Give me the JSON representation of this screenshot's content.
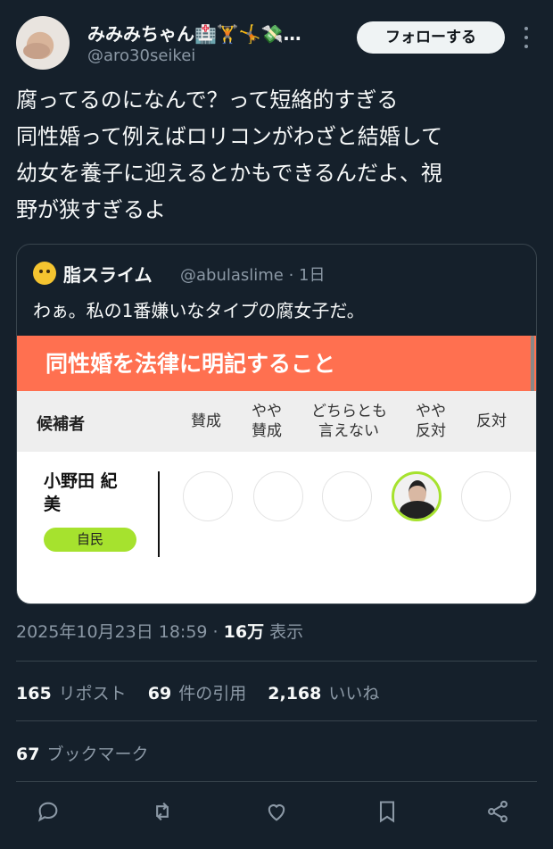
{
  "author": {
    "name": "みみみちゃん🏥🏋️🤸💸…",
    "handle": "@aro30seikei",
    "follow_label": "フォローする"
  },
  "tweet_lines": [
    "腐ってるのになんで？って短絡的すぎる",
    "同性婚って例えばロリコンがわざと結婚して",
    "幼女を養子に迎えるとかもできるんだよ、視",
    "野が狭すぎるよ"
  ],
  "quote": {
    "name": "脂スライム",
    "handle": "@abulaslime · 1日",
    "text": "わぁ。私の1番嫌いなタイプの腐女子だ。",
    "card": {
      "title": "同性婚を法律に明記すること",
      "candidate_header": "候補者",
      "columns": [
        "賛成",
        "やや\n賛成",
        "どちらとも\n言えない",
        "やや\n反対",
        "反対"
      ],
      "candidate_name": "小野田 紀\n美",
      "party": "自民",
      "selected_index": 3
    }
  },
  "meta": {
    "timestamp": "2025年10月23日 18:59",
    "separator": " · ",
    "views_count": "16万",
    "views_label": " 表示"
  },
  "stats": {
    "reposts_count": "165",
    "reposts_label": "リポスト",
    "quotes_count": "69",
    "quotes_label": "件の引用",
    "likes_count": "2,168",
    "likes_label": "いいね",
    "bookmarks_count": "67",
    "bookmarks_label": "ブックマーク"
  },
  "icons": [
    "reply-icon",
    "retweet-icon",
    "like-icon",
    "bookmark-icon",
    "share-icon"
  ],
  "colors": {
    "background": "#15202b",
    "banner": "#ff7050",
    "party": "#a6e22e"
  }
}
